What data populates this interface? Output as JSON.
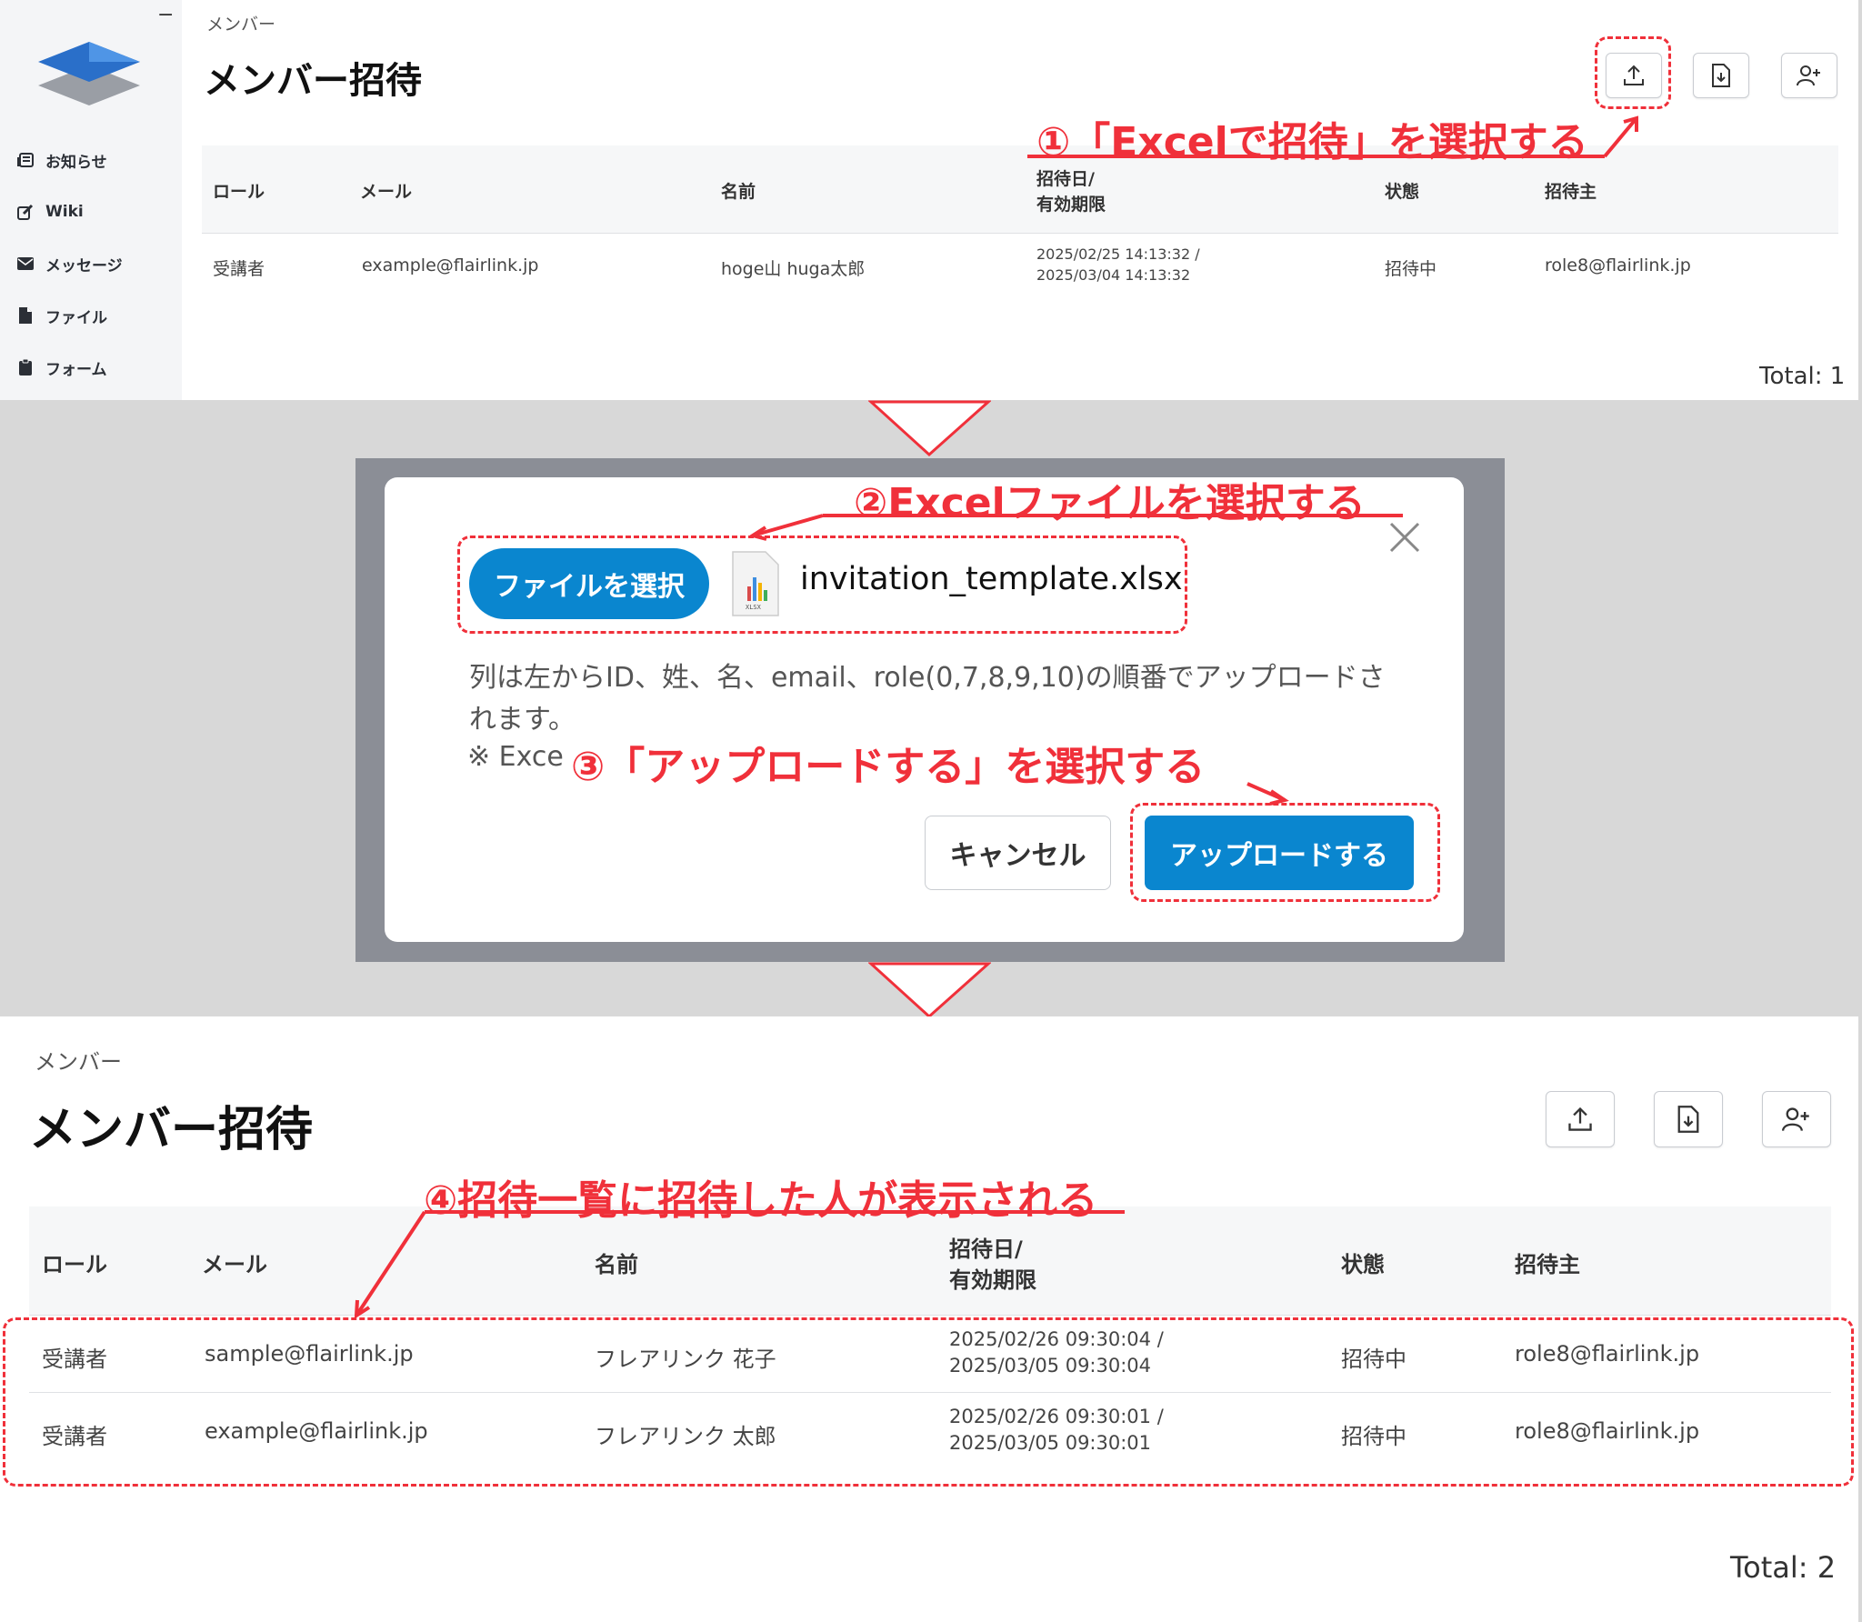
{
  "sidebar": {
    "items": [
      {
        "label": "お知らせ",
        "icon": "newspaper-icon"
      },
      {
        "label": "Wiki",
        "icon": "edit-icon"
      },
      {
        "label": "メッセージ",
        "icon": "envelope-icon"
      },
      {
        "label": "ファイル",
        "icon": "file-icon"
      },
      {
        "label": "フォーム",
        "icon": "clipboard-icon"
      }
    ]
  },
  "panel1": {
    "breadcrumb": "メンバー",
    "title": "メンバー招待",
    "table": {
      "headers": {
        "role": "ロール",
        "mail": "メール",
        "name": "名前",
        "date_line1": "招待日/",
        "date_line2": "有効期限",
        "status": "状態",
        "inviter": "招待主"
      },
      "rows": [
        {
          "role": "受講者",
          "mail": "example@flairlink.jp",
          "name": "hoge山 huga太郎",
          "date1": "2025/02/25 14:13:32 /",
          "date2": "2025/03/04 14:13:32",
          "status": "招待中",
          "inviter": "role8@flairlink.jp"
        }
      ]
    },
    "total": "Total: 1"
  },
  "dialog": {
    "file_button": "ファイルを選択",
    "file_name": "invitation_template.xlsx",
    "file_icon_label": "XLSX",
    "description": "列は左からID、姓、名、email、role(0,7,8,9,10)の順番でアップロードされます。",
    "note": "※ Exce",
    "cancel_button": "キャンセル",
    "upload_button": "アップロードする"
  },
  "panel3": {
    "breadcrumb": "メンバー",
    "title": "メンバー招待",
    "table": {
      "headers": {
        "role": "ロール",
        "mail": "メール",
        "name": "名前",
        "date_line1": "招待日/",
        "date_line2": "有効期限",
        "status": "状態",
        "inviter": "招待主"
      },
      "rows": [
        {
          "role": "受講者",
          "mail": "sample@flairlink.jp",
          "name": "フレアリンク 花子",
          "date1": "2025/02/26 09:30:04 /",
          "date2": "2025/03/05 09:30:04",
          "status": "招待中",
          "inviter": "role8@flairlink.jp"
        },
        {
          "role": "受講者",
          "mail": "example@flairlink.jp",
          "name": "フレアリンク 太郎",
          "date1": "2025/02/26 09:30:01 /",
          "date2": "2025/03/05 09:30:01",
          "status": "招待中",
          "inviter": "role8@flairlink.jp"
        }
      ]
    },
    "total": "Total: 2"
  },
  "annotations": {
    "step1": "①「Excelで招待」を選択する",
    "step2": "②Excelファイルを選択する",
    "step3": "③「アップロードする」を選択する",
    "step4": "④招待一覧に招待した人が表示される"
  },
  "colors": {
    "accent": "#0a86cf",
    "annotation": "#f0303a",
    "overlay": "#8b8e96"
  }
}
